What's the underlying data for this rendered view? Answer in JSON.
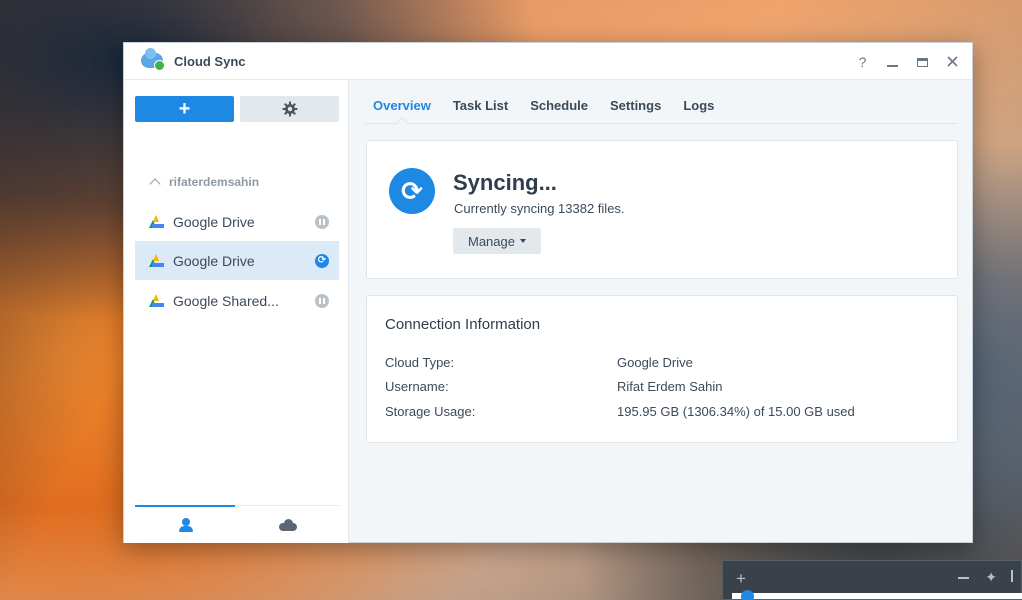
{
  "window": {
    "title": "Cloud Sync",
    "controls": {
      "help": "?"
    }
  },
  "sidebar": {
    "add_label": "+",
    "account": "rifaterdemsahin",
    "tasks": [
      {
        "label": "Google Drive",
        "status": "paused"
      },
      {
        "label": "Google Drive",
        "status": "syncing"
      },
      {
        "label": "Google Shared...",
        "status": "paused"
      }
    ]
  },
  "tabs": [
    "Overview",
    "Task List",
    "Schedule",
    "Settings",
    "Logs"
  ],
  "status": {
    "title": "Syncing...",
    "subtitle": "Currently syncing 13382 files.",
    "manage_label": "Manage"
  },
  "connection": {
    "title": "Connection Information",
    "rows": [
      {
        "key": "Cloud Type:",
        "value": "Google Drive"
      },
      {
        "key": "Username:",
        "value": "Rifat Erdem Sahin"
      },
      {
        "key": "Storage Usage:",
        "value": "195.95 GB (1306.34%) of 15.00 GB used"
      }
    ]
  },
  "dock": {
    "plus": "+"
  },
  "colors": {
    "accent": "#1e88e5",
    "paused": "#b9c1c9",
    "selected": "#dceaf7"
  }
}
